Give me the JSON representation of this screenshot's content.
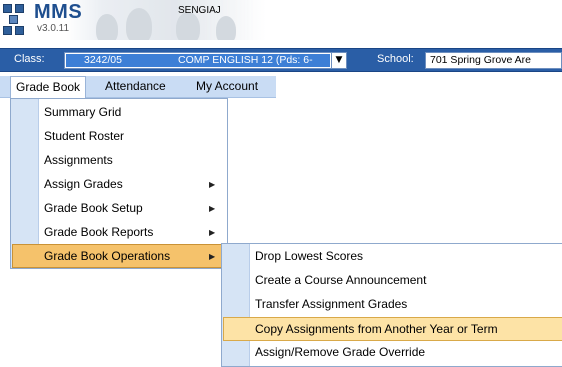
{
  "header": {
    "logo_text": "MMS",
    "version": "v3.0.11",
    "username": "SENGIAJ"
  },
  "classbar": {
    "class_label": "Class:",
    "class_code": "3242/05",
    "class_course": "COMP ENGLISH 12 (Pds: 6-",
    "class_dropdown_icon": "chevron-down-icon",
    "school_label": "School:",
    "school_value": "701 Spring Grove Are"
  },
  "menubar": {
    "items": [
      {
        "label": "Grade Book",
        "active": true
      },
      {
        "label": "Attendance",
        "active": false
      },
      {
        "label": "My Account",
        "active": false
      }
    ]
  },
  "gradebook_menu": {
    "items": [
      {
        "label": "Summary Grid",
        "submenu": false
      },
      {
        "label": "Student Roster",
        "submenu": false
      },
      {
        "label": "Assignments",
        "submenu": false
      },
      {
        "label": "Assign Grades",
        "submenu": true
      },
      {
        "label": "Grade Book Setup",
        "submenu": true
      },
      {
        "label": "Grade Book Reports",
        "submenu": true
      },
      {
        "label": "Grade Book Operations",
        "submenu": true,
        "highlighted": true
      }
    ],
    "submenu_arrow_icon": "chevron-right-icon"
  },
  "operations_submenu": {
    "items": [
      {
        "label": "Drop Lowest Scores"
      },
      {
        "label": "Create a Course Announcement"
      },
      {
        "label": "Transfer Assignment Grades"
      },
      {
        "label": "Copy Assignments from Another Year or Term",
        "highlighted": true
      },
      {
        "label": "Assign/Remove Grade Override"
      }
    ]
  },
  "colors": {
    "classbar_bg": "#2a5ea6",
    "menubar_bg": "#c9dcf4",
    "highlight": "#f5c26b",
    "hover": "#fde3a6"
  }
}
